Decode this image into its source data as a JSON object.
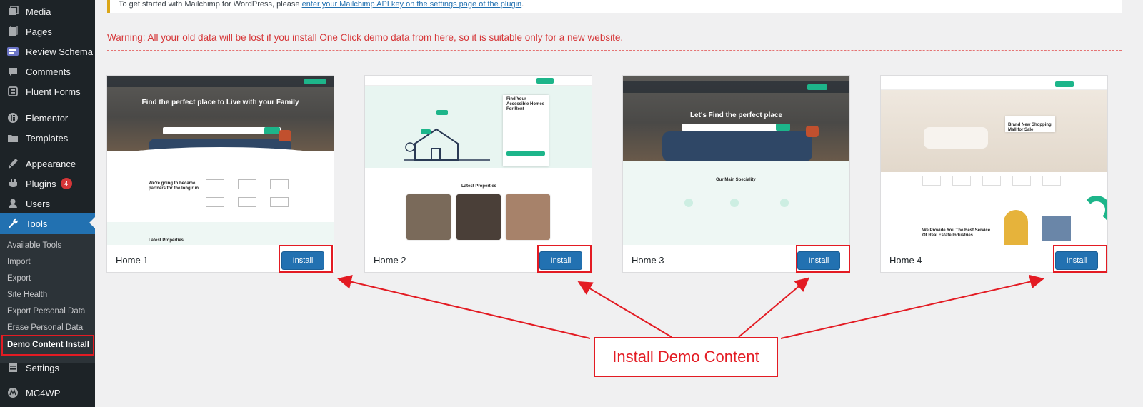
{
  "sidebar": {
    "items": [
      {
        "label": "Media",
        "icon": "media-icon"
      },
      {
        "label": "Pages",
        "icon": "pages-icon"
      },
      {
        "label": "Review Schema",
        "icon": "review-schema-icon"
      },
      {
        "label": "Comments",
        "icon": "comments-icon"
      },
      {
        "label": "Fluent Forms",
        "icon": "fluent-forms-icon"
      },
      {
        "label": "Elementor",
        "icon": "elementor-icon"
      },
      {
        "label": "Templates",
        "icon": "templates-icon"
      },
      {
        "label": "Appearance",
        "icon": "appearance-icon"
      },
      {
        "label": "Plugins",
        "icon": "plugins-icon",
        "badge": "4"
      },
      {
        "label": "Users",
        "icon": "users-icon"
      },
      {
        "label": "Tools",
        "icon": "tools-icon"
      }
    ],
    "tools_submenu": [
      "Available Tools",
      "Import",
      "Export",
      "Site Health",
      "Export Personal Data",
      "Erase Personal Data",
      "Demo Content Install"
    ],
    "after": [
      {
        "label": "Settings",
        "icon": "settings-icon"
      },
      {
        "label": "MC4WP",
        "icon": "mc4wp-icon"
      }
    ]
  },
  "notice": {
    "text": "To get started with Mailchimp for WordPress, please ",
    "link": "enter your Mailchimp API key on the settings page of the plugin",
    "end": "."
  },
  "warning": "Warning: All your old data will be lost if you install One Click demo data from here, so it is suitable only for a new website.",
  "demos": [
    {
      "title": "Home 1",
      "button": "Install",
      "hero_text": "Find the perfect place to Live with your Family",
      "section_text": "We're going to became partners for the long run",
      "latest": "Latest Properties"
    },
    {
      "title": "Home 2",
      "button": "Install",
      "hero_text": "Find Your Accessible Homes For Rent",
      "latest": "Latest Properties"
    },
    {
      "title": "Home 3",
      "button": "Install",
      "hero_text": "Let's Find the perfect place",
      "section_text": "Our Main Speciality"
    },
    {
      "title": "Home 4",
      "button": "Install",
      "hero_text": "Brand New Shopping Mall for Sale",
      "section_text": "We Provide You The Best Service Of Real Estate Industries"
    }
  ],
  "annotation": "Install Demo Content",
  "colors": {
    "accent": "#2271b1",
    "warning": "#d63638",
    "annotation": "#e31b23",
    "sidebar": "#1d2327"
  }
}
